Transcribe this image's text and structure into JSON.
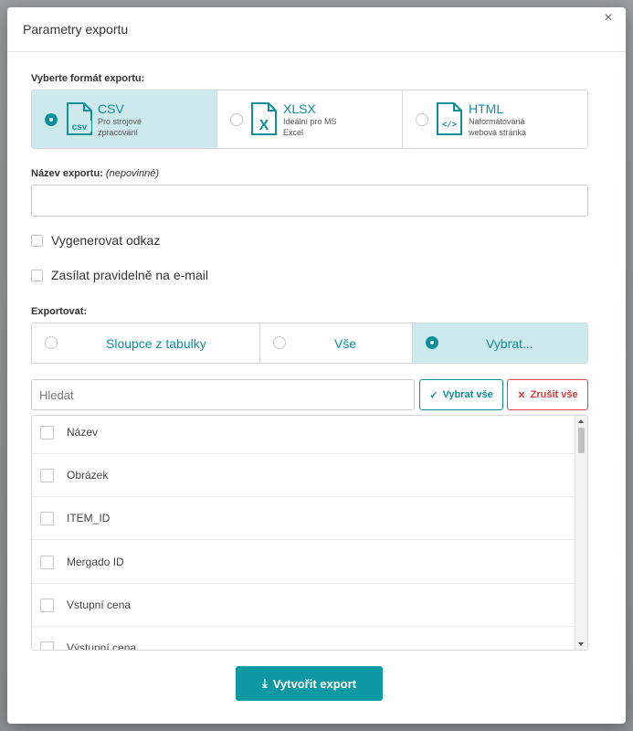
{
  "modal": {
    "title": "Parametry exportu",
    "close_label": "×"
  },
  "format": {
    "label": "Vyberte formát exportu:",
    "options": [
      {
        "name": "CSV",
        "desc": "Pro strojové zpracování",
        "icon_text": "csv",
        "icon": "csv-file-icon",
        "selected": true
      },
      {
        "name": "XLSX",
        "desc": "Ideální pro MS Excel",
        "icon_text": "X",
        "icon": "excel-file-icon",
        "selected": false
      },
      {
        "name": "HTML",
        "desc": "Naformátovaná webová stránka",
        "icon_text": "</>",
        "icon": "html-file-icon",
        "selected": false
      }
    ]
  },
  "export_name": {
    "label": "Název exportu:",
    "optional": "(nepovinné)",
    "value": "",
    "placeholder": ""
  },
  "options": {
    "generate_link": "Vygenerovat odkaz",
    "send_email": "Zasílat pravidelně na e-mail"
  },
  "export": {
    "label": "Exportovat:",
    "options": [
      {
        "label": "Sloupce z tabulky",
        "selected": false
      },
      {
        "label": "Vše",
        "selected": false
      },
      {
        "label": "Vybrat...",
        "selected": true
      }
    ]
  },
  "search": {
    "placeholder": "Hledat",
    "value": ""
  },
  "buttons": {
    "select_all": "Vybrat vše",
    "cancel_all": "Zrušit vše",
    "create_export": "Vytvořit export"
  },
  "columns": [
    "Název",
    "Obrázek",
    "ITEM_ID",
    "Mergado ID",
    "Vstupní cena",
    "Výstupní cena"
  ],
  "colors": {
    "accent": "#0e98a3",
    "selected_bg": "#cde9ec",
    "danger": "#d63b3b"
  }
}
